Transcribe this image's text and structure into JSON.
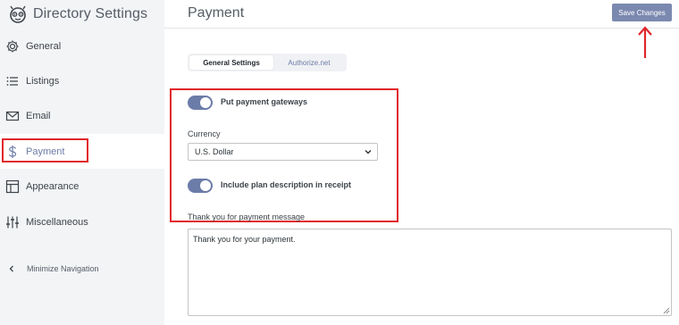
{
  "sidebar": {
    "title": "Directory Settings",
    "items": [
      {
        "label": "General",
        "icon": "gear-icon"
      },
      {
        "label": "Listings",
        "icon": "list-icon"
      },
      {
        "label": "Email",
        "icon": "envelope-icon"
      },
      {
        "label": "Payment",
        "icon": "dollar-icon",
        "active": true
      },
      {
        "label": "Appearance",
        "icon": "layout-icon"
      },
      {
        "label": "Miscellaneous",
        "icon": "sliders-icon"
      }
    ],
    "minimize_label": "Minimize Navigation"
  },
  "header": {
    "title": "Payment",
    "save_label": "Save Changes"
  },
  "tabs": [
    {
      "label": "General Settings",
      "active": true
    },
    {
      "label": "Authorize.net",
      "active": false
    }
  ],
  "settings": {
    "payment_gateways_label": "Put payment gateways",
    "payment_gateways_on": true,
    "currency_label": "Currency",
    "currency_value": "U.S. Dollar",
    "plan_description_label": "Include plan description in receipt",
    "plan_description_on": true,
    "message_label": "Thank you for payment message",
    "message_value": "Thank you for your payment."
  },
  "colors": {
    "accent": "#6c7ca8",
    "save_button": "#7b89b0",
    "annotation": "#e0262b",
    "sidebar_bg": "#f3f4f6"
  }
}
